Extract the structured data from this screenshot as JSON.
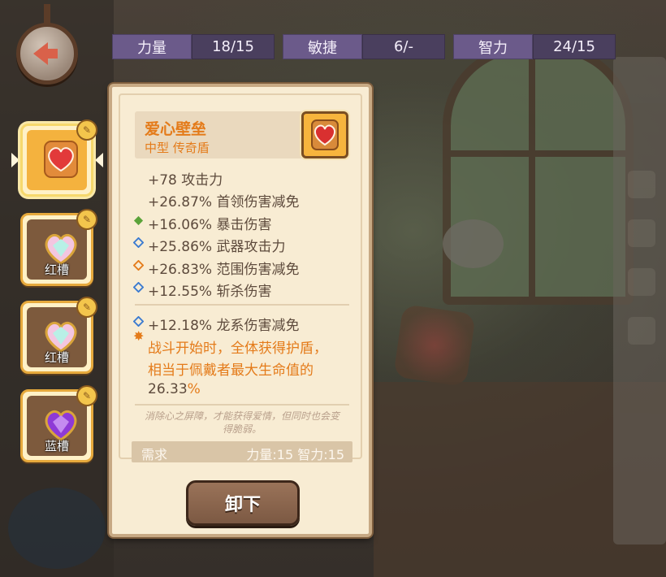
{
  "stats": [
    {
      "label": "力量",
      "value": "18/15"
    },
    {
      "label": "敏捷",
      "value": "6/-"
    },
    {
      "label": "智力",
      "value": "24/15"
    }
  ],
  "slots": [
    {
      "label": "",
      "gem": "red-heart-shield-icon",
      "selected": true
    },
    {
      "label": "红槽",
      "gem": "rainbow-heart-gem-icon",
      "selected": false
    },
    {
      "label": "红槽",
      "gem": "rainbow-heart-gem-icon",
      "selected": false
    },
    {
      "label": "蓝槽",
      "gem": "purple-heart-gem-icon",
      "selected": false
    }
  ],
  "item": {
    "name": "爱心壁垒",
    "type": "中型 传奇盾",
    "icon": "heart-shield-icon",
    "attributes": [
      {
        "text": "+78 攻击力",
        "mark": "none"
      },
      {
        "text": "+26.87% 首领伤害减免",
        "mark": "none"
      },
      {
        "text": "+16.06% 暴击伤害",
        "mark": "green-diamond"
      },
      {
        "text": "+25.86% 武器攻击力",
        "mark": "blue-diamond"
      },
      {
        "text": "+26.83% 范围伤害减免",
        "mark": "orange-diamond"
      },
      {
        "text": "+12.55% 斩杀伤害",
        "mark": "blue-diamond"
      }
    ],
    "extra_attribute": {
      "text": "+12.18% 龙系伤害减免",
      "mark": "blue-diamond"
    },
    "effect_lines": [
      "战斗开始时，全体获得护盾，",
      "相当于佩戴者最大生命值的"
    ],
    "effect_value": "26.33",
    "effect_unit": "%",
    "flavor_lines": [
      "消除心之屏障，才能获得爱情，但同时也会变",
      "得脆弱。"
    ],
    "requirement_label": "需求",
    "requirement_value": "力量:15 智力:15"
  },
  "buttons": {
    "unequip": "卸下"
  },
  "colors": {
    "accent": "#e47b1a",
    "stat_bg": "#6b5a8a",
    "card_bg": "#f8ecd3"
  }
}
